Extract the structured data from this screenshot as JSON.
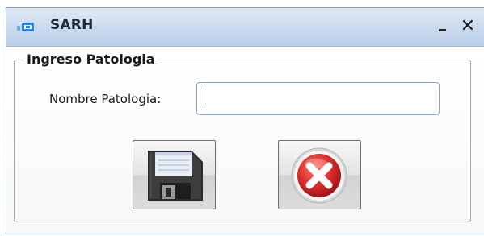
{
  "window": {
    "title": "SARH",
    "icon": "app-window-icon",
    "minimize_icon": "minimize-icon",
    "close_label": "✕"
  },
  "form": {
    "group_title": "Ingreso Patologia",
    "fields": [
      {
        "label": "Nombre Patologia:",
        "value": "",
        "placeholder": ""
      }
    ]
  },
  "buttons": {
    "save": {
      "icon": "floppy-disk-icon"
    },
    "cancel": {
      "icon": "red-x-circle-icon"
    }
  },
  "colors": {
    "titlebar": "#c9d9ee",
    "accent_blue": "#2f7fd6",
    "cancel_red": "#d9262c"
  }
}
